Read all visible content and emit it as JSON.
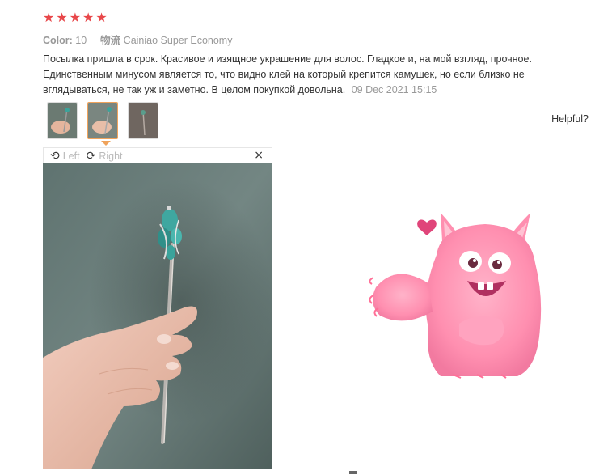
{
  "review": {
    "stars": [
      "★",
      "★",
      "★",
      "★",
      "★"
    ],
    "color_label": "Color:",
    "color_value": "10",
    "shipping_label": "物流",
    "shipping_value": "Cainiao Super Economy",
    "text": "Посылка пришла в срок. Красивое и изящное украшение для волос. Гладкое и, на мой взгляд, прочное. Единственным минусом является то, что видно клей на который крепится камушек, но если близко не вглядываться, не так уж и заметно. В целом покупкой довольна.",
    "date": "09 Dec 2021 15:15"
  },
  "helpful": "Helpful?",
  "viewer": {
    "rotate_left": "Left",
    "rotate_right": "Right",
    "close": "×"
  },
  "icons": {
    "star": "star-icon",
    "rotate_left": "rotate-left-icon",
    "rotate_right": "rotate-right-icon",
    "close": "close-icon"
  },
  "colors": {
    "star": "#e8474a",
    "active_thumb": "#f0a35b",
    "muted": "#999999"
  }
}
